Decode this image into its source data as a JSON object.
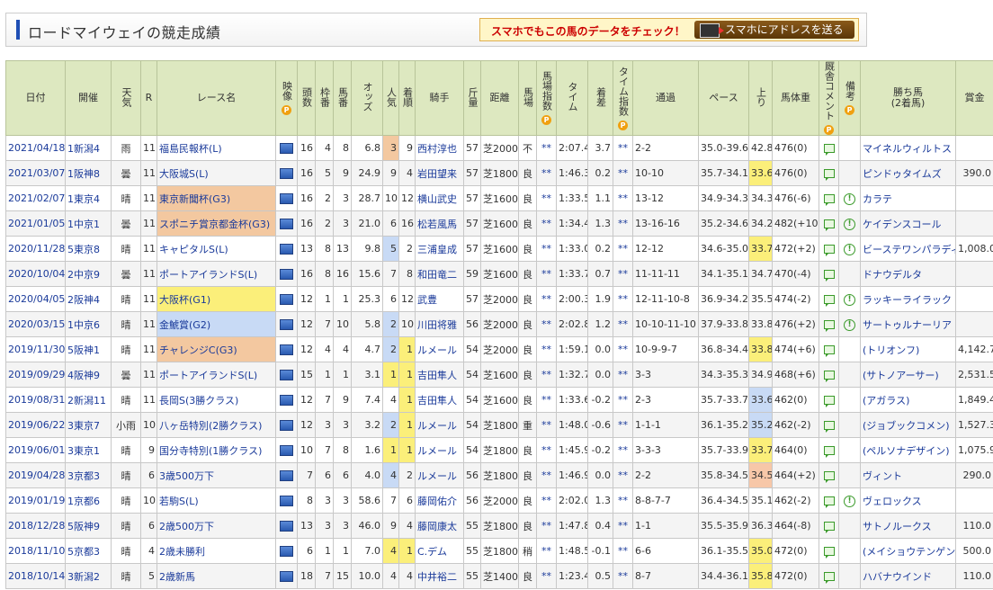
{
  "header": {
    "title": "ロードマイウェイの競走成績",
    "promo_text": "スマホでもこの馬のデータをチェック！",
    "promo_button": "スマホにアドレスを送る"
  },
  "columns": [
    "日付",
    "開催",
    "天気",
    "R",
    "レース名",
    "映像",
    "頭数",
    "枠番",
    "馬番",
    "オッズ",
    "人気",
    "着順",
    "騎手",
    "斤量",
    "距離",
    "馬場",
    "馬場指数",
    "タイム",
    "着差",
    "タイム指数",
    "通過",
    "ペース",
    "上り",
    "馬体重",
    "厩舎コメント",
    "備考",
    "勝ち馬(2着馬)",
    "賞金"
  ],
  "header_labels": {
    "date": "日付",
    "kaisai": "開催",
    "weather": "天気",
    "race": "R",
    "name": "レース名",
    "video": "映像",
    "heads": "頭数",
    "waku": "枠番",
    "umaban": "馬番",
    "odds": "オッズ",
    "pop": "人気",
    "rank": "着順",
    "jockey": "騎手",
    "weight": "斤量",
    "dist": "距離",
    "baba": "馬場",
    "baba_idx": "馬場指数",
    "time": "タイム",
    "margin": "着差",
    "time_idx": "タイム指数",
    "pass": "通過",
    "pace": "ペース",
    "last": "上り",
    "body": "馬体重",
    "comment": "厩舎コメント",
    "remark": "備考",
    "winner": "勝ち馬",
    "winner_sub": "(2着馬)",
    "prize": "賞金",
    "p_mark": "P"
  },
  "rows": [
    {
      "date": "2021/04/18",
      "kaisai": "1新潟4",
      "weather": "雨",
      "r": "11",
      "name": "福島民報杯(L)",
      "heads": "16",
      "waku": "4",
      "umaban": "8",
      "odds": "6.8",
      "pop": "3",
      "rank": "9",
      "jockey": "西村淳也",
      "kin": "57",
      "dist": "芝2000",
      "baba": "不",
      "bidx": "**",
      "time": "2:07.4",
      "margin": "3.7",
      "tidx": "**",
      "pass": "2-2",
      "pace": "35.0-39.6",
      "last": "42.8",
      "body": "476(0)",
      "cmt": true,
      "note": false,
      "winner": "マイネルウィルトス",
      "prize": ""
    },
    {
      "date": "2021/03/07",
      "kaisai": "1阪神8",
      "weather": "曇",
      "r": "11",
      "name": "大阪城S(L)",
      "heads": "16",
      "waku": "5",
      "umaban": "9",
      "odds": "24.9",
      "pop": "9",
      "rank": "4",
      "jockey": "岩田望来",
      "kin": "57",
      "dist": "芝1800",
      "baba": "良",
      "bidx": "**",
      "time": "1:46.3",
      "margin": "0.2",
      "tidx": "**",
      "pass": "10-10",
      "pace": "35.7-34.1",
      "last": "33.6",
      "body": "476(0)",
      "cmt": true,
      "note": false,
      "winner": "ピンドゥタイムズ",
      "prize": "390.0"
    },
    {
      "date": "2021/02/07",
      "kaisai": "1東京4",
      "weather": "晴",
      "r": "11",
      "name": "東京新聞杯(G3)",
      "heads": "16",
      "waku": "2",
      "umaban": "3",
      "odds": "28.7",
      "pop": "10",
      "rank": "12",
      "jockey": "横山武史",
      "kin": "57",
      "dist": "芝1600",
      "baba": "良",
      "bidx": "**",
      "time": "1:33.5",
      "margin": "1.1",
      "tidx": "**",
      "pass": "13-12",
      "pace": "34.9-34.3",
      "last": "34.3",
      "body": "476(-6)",
      "cmt": true,
      "note": true,
      "winner": "カラテ",
      "prize": ""
    },
    {
      "date": "2021/01/05",
      "kaisai": "1中京1",
      "weather": "曇",
      "r": "11",
      "name": "スポニチ賞京都金杯(G3)",
      "heads": "16",
      "waku": "2",
      "umaban": "3",
      "odds": "21.0",
      "pop": "6",
      "rank": "16",
      "jockey": "松若風馬",
      "kin": "57",
      "dist": "芝1600",
      "baba": "良",
      "bidx": "**",
      "time": "1:34.4",
      "margin": "1.3",
      "tidx": "**",
      "pass": "13-16-16",
      "pace": "35.2-34.6",
      "last": "34.2",
      "body": "482(+10)",
      "cmt": true,
      "note": true,
      "winner": "ケイデンスコール",
      "prize": ""
    },
    {
      "date": "2020/11/28",
      "kaisai": "5東京8",
      "weather": "晴",
      "r": "11",
      "name": "キャピタルS(L)",
      "heads": "13",
      "waku": "8",
      "umaban": "13",
      "odds": "9.8",
      "pop": "5",
      "rank": "2",
      "jockey": "三浦皇成",
      "kin": "57",
      "dist": "芝1600",
      "baba": "良",
      "bidx": "**",
      "time": "1:33.0",
      "margin": "0.2",
      "tidx": "**",
      "pass": "12-12",
      "pace": "34.6-35.0",
      "last": "33.7",
      "body": "472(+2)",
      "cmt": true,
      "note": true,
      "winner": "ビーステワンパラディ",
      "prize": "1,008.0"
    },
    {
      "date": "2020/10/04",
      "kaisai": "2中京9",
      "weather": "曇",
      "r": "11",
      "name": "ポートアイランドS(L)",
      "heads": "16",
      "waku": "8",
      "umaban": "16",
      "odds": "15.6",
      "pop": "7",
      "rank": "8",
      "jockey": "和田竜二",
      "kin": "59",
      "dist": "芝1600",
      "baba": "良",
      "bidx": "**",
      "time": "1:33.7",
      "margin": "0.7",
      "tidx": "**",
      "pass": "11-11-11",
      "pace": "34.1-35.1",
      "last": "34.7",
      "body": "470(-4)",
      "cmt": true,
      "note": false,
      "winner": "ドナウデルタ",
      "prize": ""
    },
    {
      "date": "2020/04/05",
      "kaisai": "2阪神4",
      "weather": "晴",
      "r": "11",
      "name": "大阪杯(G1)",
      "heads": "12",
      "waku": "1",
      "umaban": "1",
      "odds": "25.3",
      "pop": "6",
      "rank": "12",
      "jockey": "武豊",
      "kin": "57",
      "dist": "芝2000",
      "baba": "良",
      "bidx": "**",
      "time": "2:00.3",
      "margin": "1.9",
      "tidx": "**",
      "pass": "12-11-10-8",
      "pace": "36.9-34.2",
      "last": "35.5",
      "body": "474(-2)",
      "cmt": true,
      "note": true,
      "winner": "ラッキーライラック",
      "prize": ""
    },
    {
      "date": "2020/03/15",
      "kaisai": "1中京6",
      "weather": "晴",
      "r": "11",
      "name": "金鯱賞(G2)",
      "heads": "12",
      "waku": "7",
      "umaban": "10",
      "odds": "5.8",
      "pop": "2",
      "rank": "10",
      "jockey": "川田将雅",
      "kin": "56",
      "dist": "芝2000",
      "baba": "良",
      "bidx": "**",
      "time": "2:02.8",
      "margin": "1.2",
      "tidx": "**",
      "pass": "10-10-11-10",
      "pace": "37.9-33.8",
      "last": "33.8",
      "body": "476(+2)",
      "cmt": true,
      "note": true,
      "winner": "サートゥルナーリア",
      "prize": ""
    },
    {
      "date": "2019/11/30",
      "kaisai": "5阪神1",
      "weather": "晴",
      "r": "11",
      "name": "チャレンジC(G3)",
      "heads": "12",
      "waku": "4",
      "umaban": "4",
      "odds": "4.7",
      "pop": "2",
      "rank": "1",
      "jockey": "ルメール",
      "kin": "54",
      "dist": "芝2000",
      "baba": "良",
      "bidx": "**",
      "time": "1:59.1",
      "margin": "0.0",
      "tidx": "**",
      "pass": "10-9-9-7",
      "pace": "36.8-34.4",
      "last": "33.8",
      "body": "474(+6)",
      "cmt": true,
      "note": false,
      "winner": "(トリオンフ)",
      "prize": "4,142.7"
    },
    {
      "date": "2019/09/29",
      "kaisai": "4阪神9",
      "weather": "曇",
      "r": "11",
      "name": "ポートアイランドS(L)",
      "heads": "15",
      "waku": "1",
      "umaban": "1",
      "odds": "3.1",
      "pop": "1",
      "rank": "1",
      "jockey": "吉田隼人",
      "kin": "54",
      "dist": "芝1600",
      "baba": "良",
      "bidx": "**",
      "time": "1:32.7",
      "margin": "0.0",
      "tidx": "**",
      "pass": "3-3",
      "pace": "34.3-35.3",
      "last": "34.9",
      "body": "468(+6)",
      "cmt": true,
      "note": false,
      "winner": "(サトノアーサー)",
      "prize": "2,531.5"
    },
    {
      "date": "2019/08/31",
      "kaisai": "2新潟11",
      "weather": "晴",
      "r": "11",
      "name": "長岡S(3勝クラス)",
      "heads": "12",
      "waku": "7",
      "umaban": "9",
      "odds": "7.4",
      "pop": "4",
      "rank": "1",
      "jockey": "吉田隼人",
      "kin": "54",
      "dist": "芝1600",
      "baba": "良",
      "bidx": "**",
      "time": "1:33.6",
      "margin": "-0.2",
      "tidx": "**",
      "pass": "2-3",
      "pace": "35.7-33.7",
      "last": "33.6",
      "body": "462(0)",
      "cmt": true,
      "note": false,
      "winner": "(アガラス)",
      "prize": "1,849.4"
    },
    {
      "date": "2019/06/22",
      "kaisai": "3東京7",
      "weather": "小雨",
      "r": "10",
      "name": "八ヶ岳特別(2勝クラス)",
      "heads": "12",
      "waku": "3",
      "umaban": "3",
      "odds": "3.2",
      "pop": "2",
      "rank": "1",
      "jockey": "ルメール",
      "kin": "54",
      "dist": "芝1800",
      "baba": "重",
      "bidx": "**",
      "time": "1:48.0",
      "margin": "-0.6",
      "tidx": "**",
      "pass": "1-1-1",
      "pace": "36.1-35.2",
      "last": "35.2",
      "body": "462(-2)",
      "cmt": true,
      "note": false,
      "winner": "(ジョブックコメン)",
      "prize": "1,527.3"
    },
    {
      "date": "2019/06/01",
      "kaisai": "3東京1",
      "weather": "晴",
      "r": "9",
      "name": "国分寺特別(1勝クラス)",
      "heads": "10",
      "waku": "7",
      "umaban": "8",
      "odds": "1.6",
      "pop": "1",
      "rank": "1",
      "jockey": "ルメール",
      "kin": "54",
      "dist": "芝1800",
      "baba": "良",
      "bidx": "**",
      "time": "1:45.9",
      "margin": "-0.2",
      "tidx": "**",
      "pass": "3-3-3",
      "pace": "35.7-33.9",
      "last": "33.7",
      "body": "464(0)",
      "cmt": true,
      "note": false,
      "winner": "(ペルソナデザイン)",
      "prize": "1,075.9"
    },
    {
      "date": "2019/04/28",
      "kaisai": "3京都3",
      "weather": "晴",
      "r": "6",
      "name": "3歳500万下",
      "heads": "7",
      "waku": "6",
      "umaban": "6",
      "odds": "4.0",
      "pop": "4",
      "rank": "2",
      "jockey": "ルメール",
      "kin": "56",
      "dist": "芝1800",
      "baba": "良",
      "bidx": "**",
      "time": "1:46.9",
      "margin": "0.0",
      "tidx": "**",
      "pass": "2-2",
      "pace": "35.8-34.5",
      "last": "34.5",
      "body": "464(+2)",
      "cmt": true,
      "note": false,
      "winner": "ヴィント",
      "prize": "290.0"
    },
    {
      "date": "2019/01/19",
      "kaisai": "1京都6",
      "weather": "晴",
      "r": "10",
      "name": "若駒S(L)",
      "heads": "8",
      "waku": "3",
      "umaban": "3",
      "odds": "58.6",
      "pop": "7",
      "rank": "6",
      "jockey": "藤岡佑介",
      "kin": "56",
      "dist": "芝2000",
      "baba": "良",
      "bidx": "**",
      "time": "2:02.0",
      "margin": "1.3",
      "tidx": "**",
      "pass": "8-8-7-7",
      "pace": "36.4-34.5",
      "last": "35.1",
      "body": "462(-2)",
      "cmt": true,
      "note": true,
      "winner": "ヴェロックス",
      "prize": ""
    },
    {
      "date": "2018/12/28",
      "kaisai": "5阪神9",
      "weather": "晴",
      "r": "6",
      "name": "2歳500万下",
      "heads": "13",
      "waku": "3",
      "umaban": "3",
      "odds": "46.0",
      "pop": "9",
      "rank": "4",
      "jockey": "藤岡康太",
      "kin": "55",
      "dist": "芝1800",
      "baba": "良",
      "bidx": "**",
      "time": "1:47.8",
      "margin": "0.4",
      "tidx": "**",
      "pass": "1-1",
      "pace": "35.5-35.9",
      "last": "36.3",
      "body": "464(-8)",
      "cmt": true,
      "note": false,
      "winner": "サトノルークス",
      "prize": "110.0"
    },
    {
      "date": "2018/11/10",
      "kaisai": "5京都3",
      "weather": "晴",
      "r": "4",
      "name": "2歳未勝利",
      "heads": "6",
      "waku": "1",
      "umaban": "1",
      "odds": "7.0",
      "pop": "4",
      "rank": "1",
      "jockey": "C.デム",
      "kin": "55",
      "dist": "芝1800",
      "baba": "稍",
      "bidx": "**",
      "time": "1:48.5",
      "margin": "-0.1",
      "tidx": "**",
      "pass": "6-6",
      "pace": "36.1-35.5",
      "last": "35.0",
      "body": "472(0)",
      "cmt": true,
      "note": false,
      "winner": "(メイショウテンゲン)",
      "prize": "500.0"
    },
    {
      "date": "2018/10/14",
      "kaisai": "3新潟2",
      "weather": "晴",
      "r": "5",
      "name": "2歳新馬",
      "heads": "18",
      "waku": "7",
      "umaban": "15",
      "odds": "10.0",
      "pop": "4",
      "rank": "4",
      "jockey": "中井裕二",
      "kin": "55",
      "dist": "芝1400",
      "baba": "良",
      "bidx": "**",
      "time": "1:23.4",
      "margin": "0.5",
      "tidx": "**",
      "pass": "8-7",
      "pace": "34.4-36.1",
      "last": "35.8",
      "body": "472(0)",
      "cmt": true,
      "note": false,
      "winner": "ハバナウインド",
      "prize": "110.0"
    }
  ],
  "highlights": {
    "name_grade_colors": {
      "G1": "#fbef7a",
      "G2": "#c8daf5",
      "G3": "#f3c8a0"
    },
    "pop_top_color": "#fbef7a",
    "pop_second_color": "#c8daf5",
    "pop_third_color": "#f3c8a0",
    "last_best_color": "#fbef7a",
    "last_second_color": "#c8daf5",
    "last_third_color": "#f7c7a8"
  },
  "highlight_cells": {
    "name": {
      "2": "G3",
      "3": "G3",
      "6": "G1",
      "7": "G2",
      "8": "G3"
    },
    "pop": {
      "0": "third",
      "4": "second",
      "7": "second",
      "8": "second",
      "9": "top",
      "11": "second",
      "12": "top",
      "13": "second",
      "16": "top"
    },
    "rank": {
      "8": "top",
      "9": "top",
      "10": "top",
      "11": "top",
      "12": "top",
      "16": "top"
    },
    "last": {
      "1": "top",
      "4": "top",
      "8": "top",
      "10": "second",
      "11": "second",
      "12": "top",
      "13": "third",
      "16": "top",
      "17": "top"
    }
  }
}
